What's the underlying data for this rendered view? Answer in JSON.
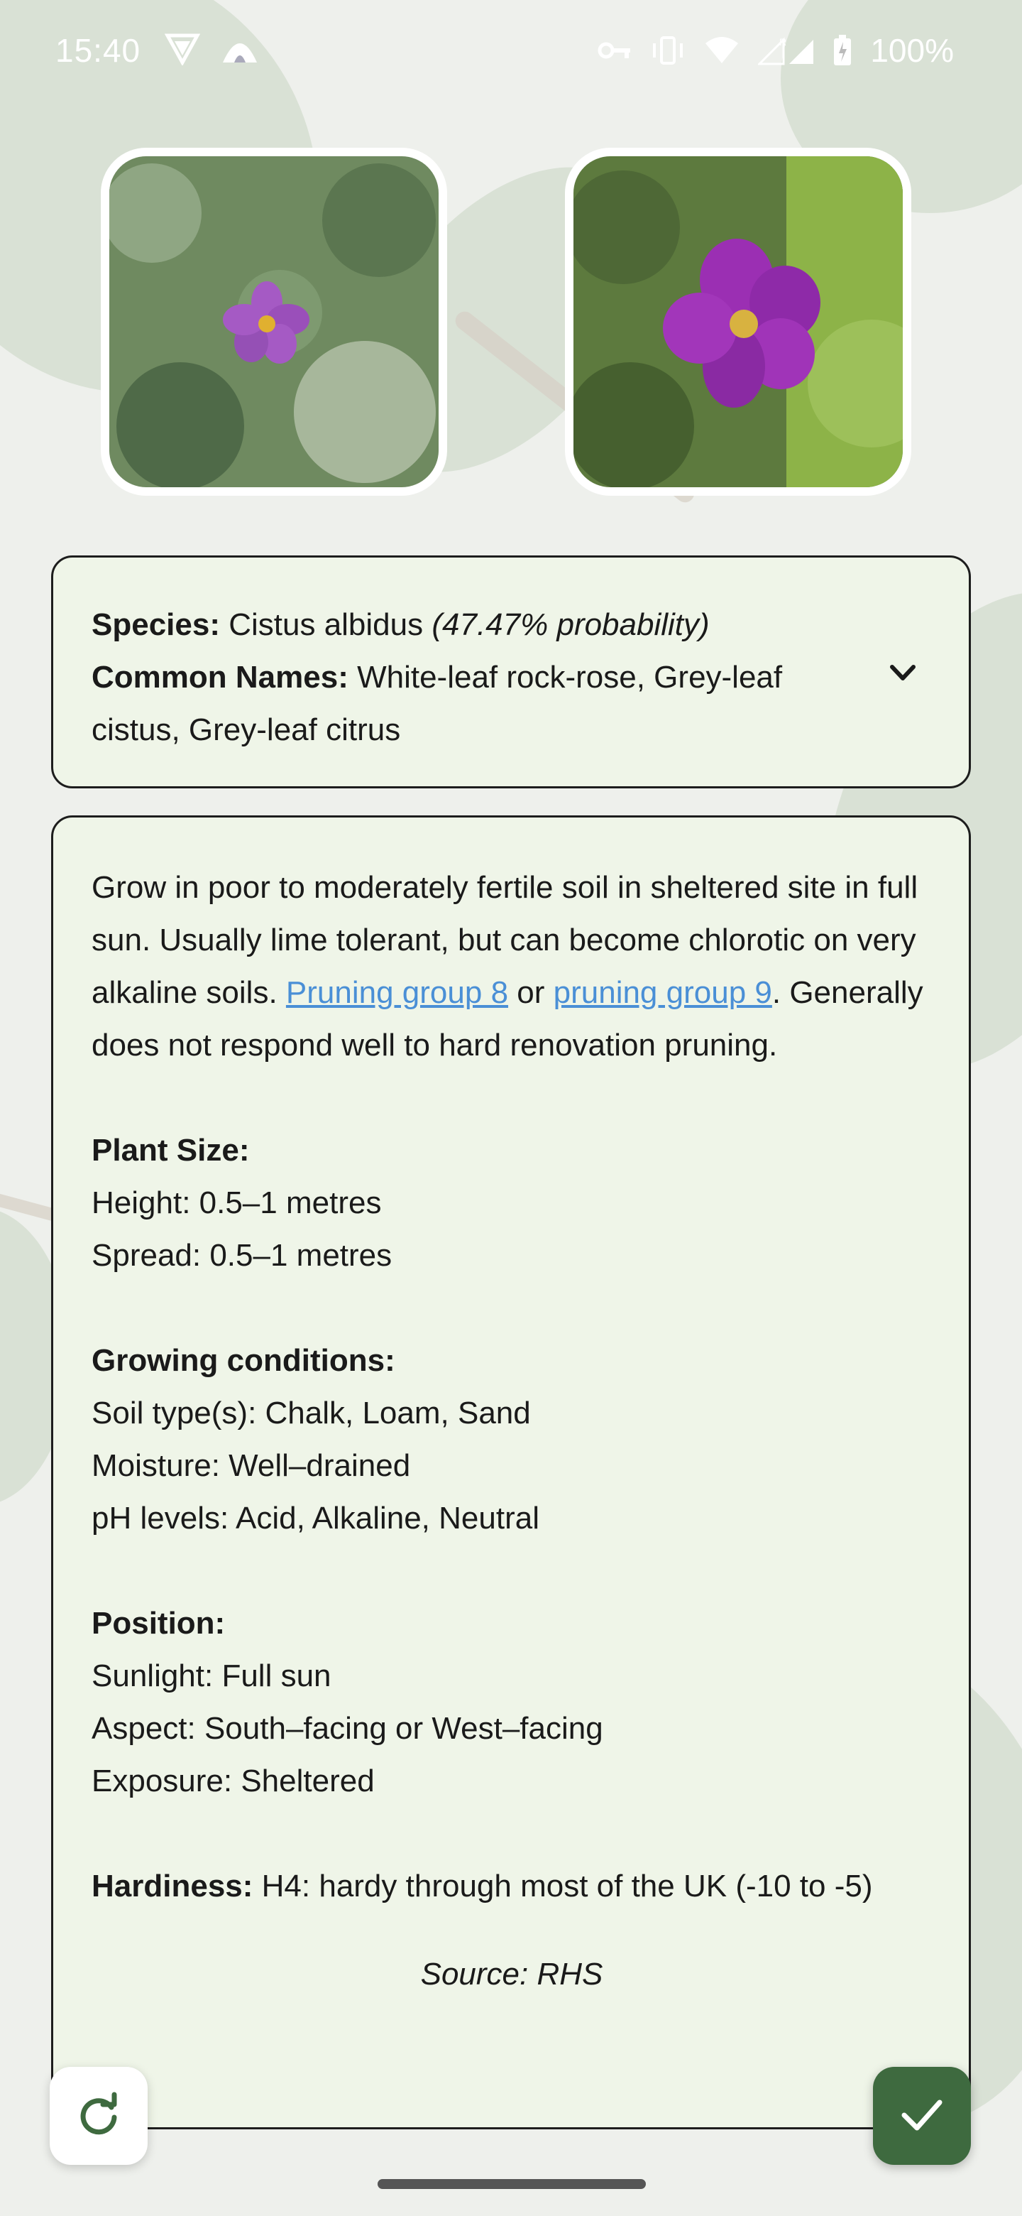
{
  "status_bar": {
    "time": "15:40",
    "battery": "100%"
  },
  "photos": [
    {
      "name": "plant-photo-1",
      "description_icon": "flower-photo"
    },
    {
      "name": "plant-photo-2",
      "description_icon": "flower-photo"
    }
  ],
  "species_card": {
    "species_label": "Species:",
    "species_name": "Cistus albidus",
    "probability": "(47.47% probability)",
    "common_names_label": "Common Names:",
    "common_names": "White-leaf rock-rose, Grey-leaf cistus, Grey-leaf citrus"
  },
  "info_card": {
    "intro": "Grow in poor to moderately fertile soil in sheltered site in full sun. Usually lime tolerant, but can become chlorotic on very alkaline soils.",
    "link1": "Pruning group 8",
    "or_text": " or ",
    "link2": "pruning group 9",
    "after_links": ". Generally does not respond well to hard renovation pruning.",
    "plant_size_label": "Plant Size:",
    "height": "Height: 0.5–1 metres",
    "spread": "Spread: 0.5–1 metres",
    "growing_label": "Growing conditions:",
    "soil": "Soil type(s): Chalk, Loam, Sand",
    "moisture": "Moisture: Well–drained",
    "ph": "pH levels: Acid, Alkaline, Neutral",
    "position_label": "Position:",
    "sunlight": "Sunlight: Full sun",
    "aspect": "Aspect: South–facing or West–facing",
    "exposure": "Exposure: Sheltered",
    "hardiness_label": "Hardiness:",
    "hardiness": " H4: hardy through most of the UK (-10 to -5)",
    "source": "Source: RHS"
  },
  "colors": {
    "card_bg": "#eff5e8",
    "link": "#4a8fd6",
    "confirm_fab": "#3e6a3f"
  },
  "icons": {
    "expand": "chevron-down-icon",
    "refresh": "refresh-icon",
    "confirm": "check-icon"
  }
}
